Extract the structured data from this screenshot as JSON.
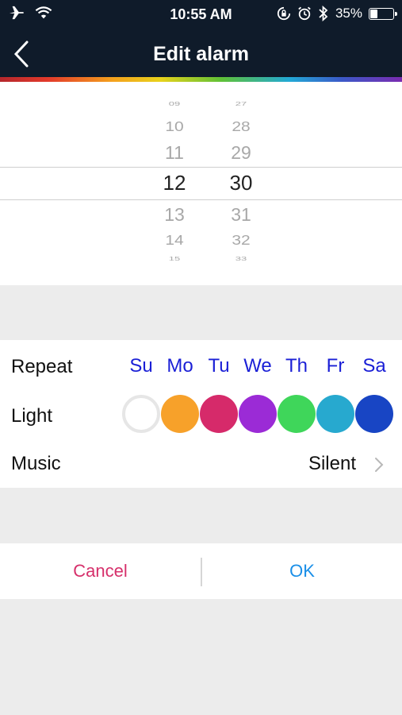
{
  "status_bar": {
    "time": "10:55 AM",
    "battery_percent_label": "35%",
    "battery_level": 0.35,
    "icons": [
      "airplane-icon",
      "wifi-icon",
      "rotation-lock-icon",
      "alarm-clock-icon",
      "bluetooth-icon",
      "battery-icon"
    ]
  },
  "nav": {
    "title": "Edit alarm",
    "back_icon": "chevron-left-icon"
  },
  "time_picker": {
    "hours": [
      "09",
      "10",
      "11",
      "12",
      "13",
      "14",
      "15"
    ],
    "minutes": [
      "27",
      "28",
      "29",
      "30",
      "31",
      "32",
      "33"
    ],
    "selected_hour": "12",
    "selected_minute": "30"
  },
  "settings": {
    "repeat_label": "Repeat",
    "days": [
      "Su",
      "Mo",
      "Tu",
      "We",
      "Th",
      "Fr",
      "Sa"
    ],
    "light_label": "Light",
    "light_colors": [
      "#ffffff",
      "#f7a12a",
      "#d62a6a",
      "#9b2bd6",
      "#3fd65a",
      "#27a9cf",
      "#1845c4"
    ],
    "music_label": "Music",
    "music_value": "Silent"
  },
  "actions": {
    "cancel_label": "Cancel",
    "ok_label": "OK"
  },
  "colors": {
    "header_bg": "#0f1b2a",
    "day_text": "#1a1fd6",
    "cancel_text": "#d6306b",
    "ok_text": "#1a8fe8"
  }
}
